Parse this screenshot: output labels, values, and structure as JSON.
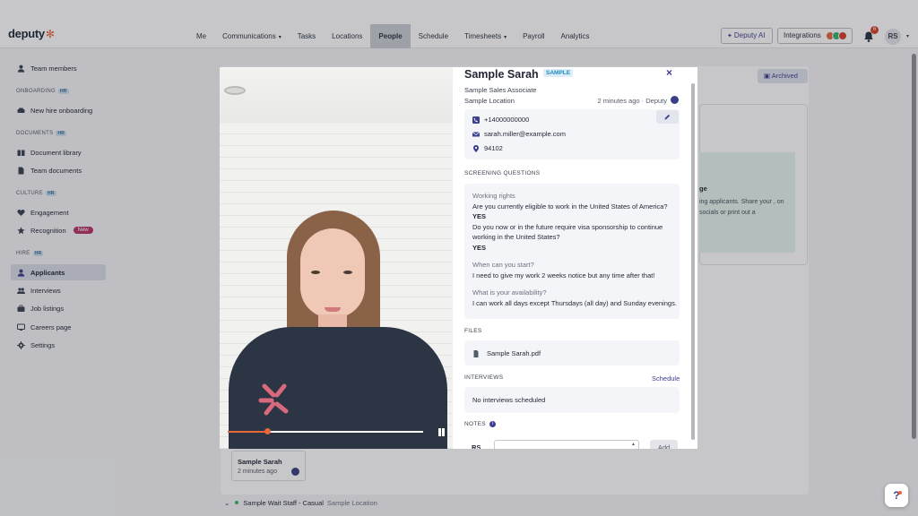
{
  "app": {
    "logo": "deputy",
    "logo_mark": "✻"
  },
  "nav": [
    {
      "label": "Me"
    },
    {
      "label": "Communications",
      "caret": "▾"
    },
    {
      "label": "Tasks"
    },
    {
      "label": "Locations"
    },
    {
      "label": "People",
      "active": true
    },
    {
      "label": "Schedule"
    },
    {
      "label": "Timesheets",
      "caret": "▾"
    },
    {
      "label": "Payroll"
    },
    {
      "label": "Analytics"
    }
  ],
  "topbar": {
    "ai_label": "Deputy AI",
    "integrations_label": "Integrations",
    "notification_count": "6",
    "avatar": "RS"
  },
  "sidebar": {
    "team_members": "Team members",
    "onboarding_section": "ONBOARDING",
    "new_hire": "New hire onboarding",
    "documents_section": "DOCUMENTS",
    "document_library": "Document library",
    "team_documents": "Team documents",
    "culture_section": "CULTURE",
    "engagement": "Engagement",
    "recognition": "Recognition",
    "new_badge": "New",
    "hire_section": "HIRE",
    "applicants": "Applicants",
    "interviews": "Interviews",
    "job_listings": "Job listings",
    "careers_page": "Careers page",
    "settings": "Settings",
    "hr_tag": "HR"
  },
  "background": {
    "archived": "Archived",
    "green_title": "ge",
    "green_text": "ing applicants. Share your , on socials or print out a",
    "caption_name": "Sample Sarah",
    "caption_time": "2 minutes ago",
    "row_title": "Sample Wait Staff - Casual",
    "row_location": "Sample Location"
  },
  "video": {
    "progress": 0.2
  },
  "applicant": {
    "name": "Sample Sarah",
    "tag": "SAMPLE",
    "role": "Sample Sales Associate",
    "location": "Sample Location",
    "time": "2 minutes ago · Deputy",
    "phone": "+14000000000",
    "email": "sarah.miller@example.com",
    "zip": "94102"
  },
  "screening": {
    "heading": "SCREENING QUESTIONS",
    "working_rights_label": "Working rights",
    "q1": "Are you currently eligible to work in the United States of America?",
    "a1": "YES",
    "q2": "Do you now or in the future require visa sponsorship to continue working in the United States?",
    "a2": "YES",
    "start_label": "When can you start?",
    "start_answer": "I need to give my work 2 weeks notice but any time after that!",
    "availability_label": "What is your availability?",
    "availability_answer": "I can work all days except Thursdays (all day) and Sunday evenings."
  },
  "files": {
    "heading": "FILES",
    "file_name": "Sample Sarah.pdf"
  },
  "interviews": {
    "heading": "INTERVIEWS",
    "schedule_link": "Schedule",
    "empty": "No interviews scheduled"
  },
  "notes": {
    "heading": "NOTES",
    "author": "RS",
    "add": "Add",
    "placeholder": ""
  },
  "help": {
    "label": "?"
  },
  "colors": {
    "accent": "#3d3f8f",
    "brand_orange": "#e8663c",
    "active_nav": "#c9ccd2"
  }
}
